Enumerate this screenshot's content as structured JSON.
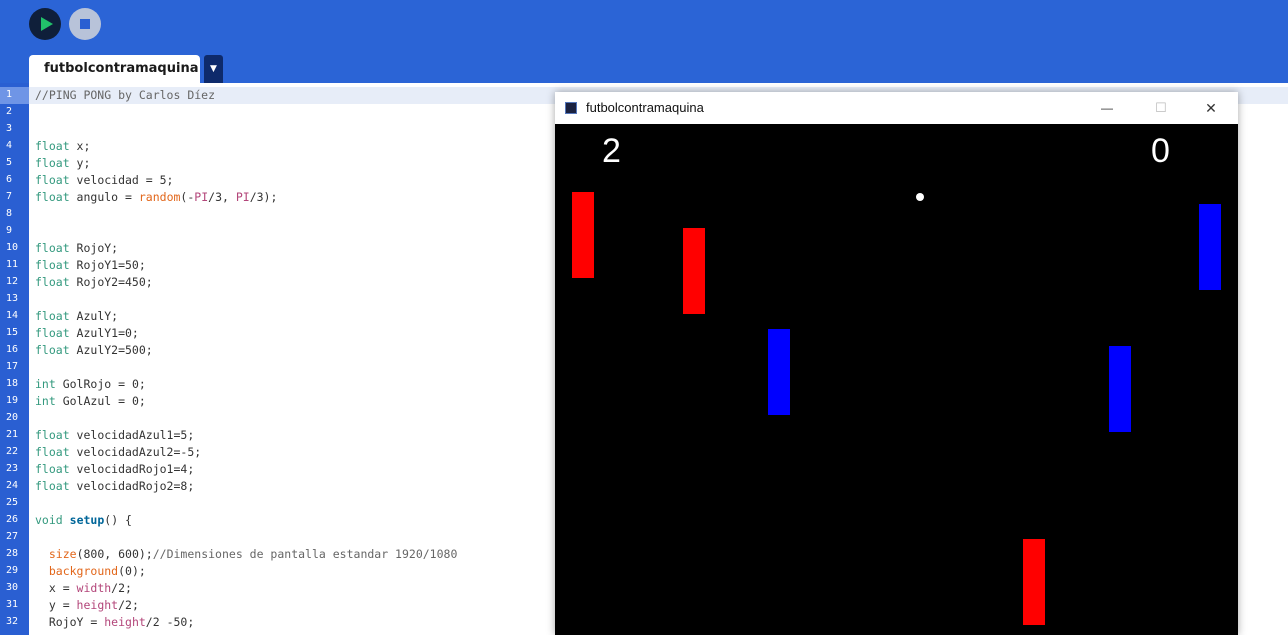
{
  "ide": {
    "run_label": "Run",
    "stop_label": "Stop",
    "tab_name": "futbolcontramaquina",
    "tab_menu_glyph": "▼"
  },
  "editor": {
    "lines": [
      {
        "n": "1",
        "t": "//PING PONG by Carlos Díez"
      },
      {
        "n": "2",
        "t": ""
      },
      {
        "n": "3",
        "t": ""
      },
      {
        "n": "4",
        "t": "float x;"
      },
      {
        "n": "5",
        "t": "float y;"
      },
      {
        "n": "6",
        "t": "float velocidad = 5;"
      },
      {
        "n": "7",
        "t": "float angulo = random(-PI/3, PI/3);"
      },
      {
        "n": "8",
        "t": ""
      },
      {
        "n": "9",
        "t": ""
      },
      {
        "n": "10",
        "t": "float RojoY;"
      },
      {
        "n": "11",
        "t": "float RojoY1=50;"
      },
      {
        "n": "12",
        "t": "float RojoY2=450;"
      },
      {
        "n": "13",
        "t": ""
      },
      {
        "n": "14",
        "t": "float AzulY;"
      },
      {
        "n": "15",
        "t": "float AzulY1=0;"
      },
      {
        "n": "16",
        "t": "float AzulY2=500;"
      },
      {
        "n": "17",
        "t": ""
      },
      {
        "n": "18",
        "t": "int GolRojo = 0;"
      },
      {
        "n": "19",
        "t": "int GolAzul = 0;"
      },
      {
        "n": "20",
        "t": ""
      },
      {
        "n": "21",
        "t": "float velocidadAzul1=5;"
      },
      {
        "n": "22",
        "t": "float velocidadAzul2=-5;"
      },
      {
        "n": "23",
        "t": "float velocidadRojo1=4;"
      },
      {
        "n": "24",
        "t": "float velocidadRojo2=8;"
      },
      {
        "n": "25",
        "t": ""
      },
      {
        "n": "26",
        "t": "void setup() {"
      },
      {
        "n": "27",
        "t": ""
      },
      {
        "n": "28",
        "t": "  size(800, 600);//Dimensiones de pantalla estandar 1920/1080"
      },
      {
        "n": "29",
        "t": "  background(0);"
      },
      {
        "n": "30",
        "t": "  x = width/2;"
      },
      {
        "n": "31",
        "t": "  y = height/2;"
      },
      {
        "n": "32",
        "t": "  RojoY = height/2 -50;"
      }
    ]
  },
  "sketch_window": {
    "title": "futbolcontramaquina",
    "minimize_glyph": "—",
    "maximize_glyph": "☐",
    "close_glyph": "✕",
    "score_left": "2",
    "score_right": "0",
    "colors": {
      "red_paddle": "#ff0000",
      "blue_paddle": "#0000ff",
      "background": "#000000",
      "ball": "#ffffff"
    }
  }
}
